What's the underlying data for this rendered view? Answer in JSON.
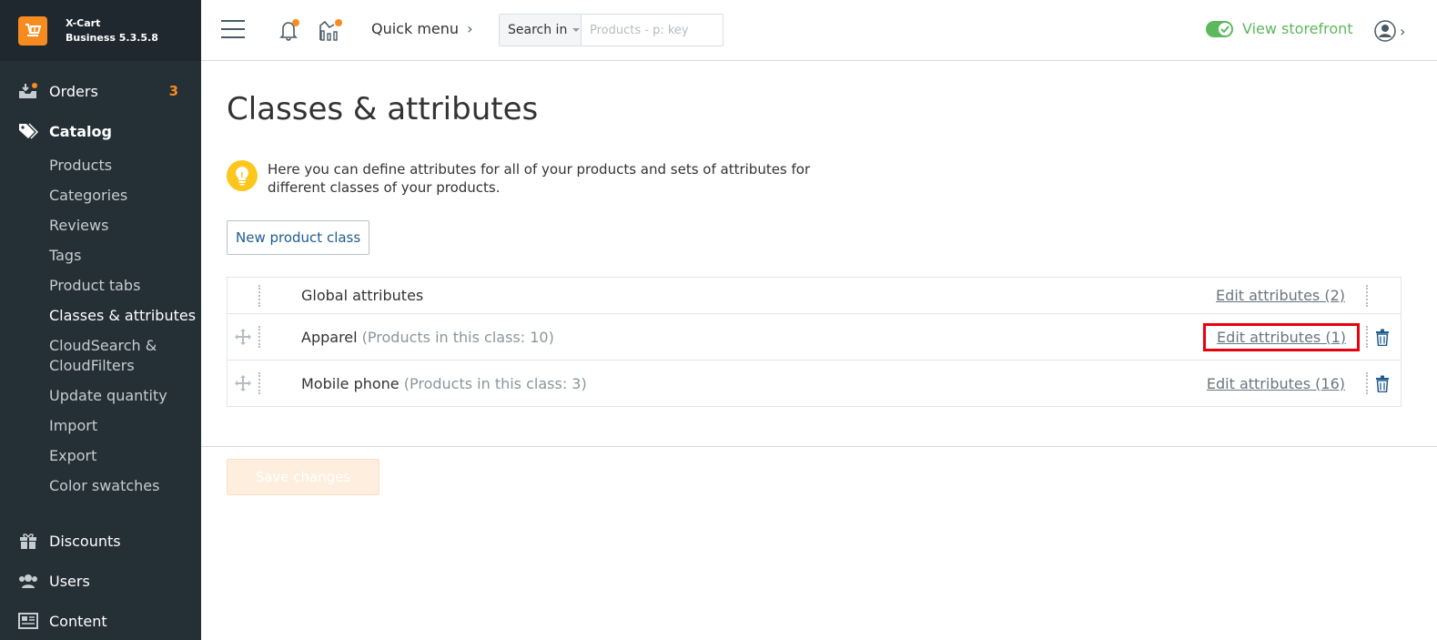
{
  "brand": {
    "line1": "X-Cart",
    "line2": "Business 5.3.5.8"
  },
  "sidebar": {
    "orders": {
      "label": "Orders",
      "count": "3"
    },
    "catalog": {
      "label": "Catalog"
    },
    "catalog_items": [
      "Products",
      "Categories",
      "Reviews",
      "Tags",
      "Product tabs",
      "Classes & attributes",
      "CloudSearch & CloudFilters",
      "Update quantity",
      "Import",
      "Export",
      "Color swatches"
    ],
    "discounts": {
      "label": "Discounts"
    },
    "users": {
      "label": "Users"
    },
    "content": {
      "label": "Content"
    }
  },
  "header": {
    "quick_menu": "Quick menu",
    "search_in_label": "Search in",
    "search_placeholder": "Products - p: key",
    "view_storefront": "View storefront"
  },
  "page": {
    "title": "Classes & attributes",
    "info_text": "Here you can define attributes for all of your products and sets of attributes for different classes of your products.",
    "new_button": "New product class",
    "save_button": "Save changes"
  },
  "classes": [
    {
      "name": "Global attributes",
      "count": "",
      "edit": "Edit attributes (2)"
    },
    {
      "name": "Apparel",
      "count": "(Products in this class: 10)",
      "edit": "Edit attributes (1)"
    },
    {
      "name": "Mobile phone",
      "count": "(Products in this class: 3)",
      "edit": "Edit attributes (16)"
    }
  ],
  "colors": {
    "accent": "#f68b1f",
    "sidebar_bg": "#252f36",
    "storefront_green": "#5cb85c",
    "link_blue": "#1d5d90",
    "highlight_red": "#e8000b"
  }
}
